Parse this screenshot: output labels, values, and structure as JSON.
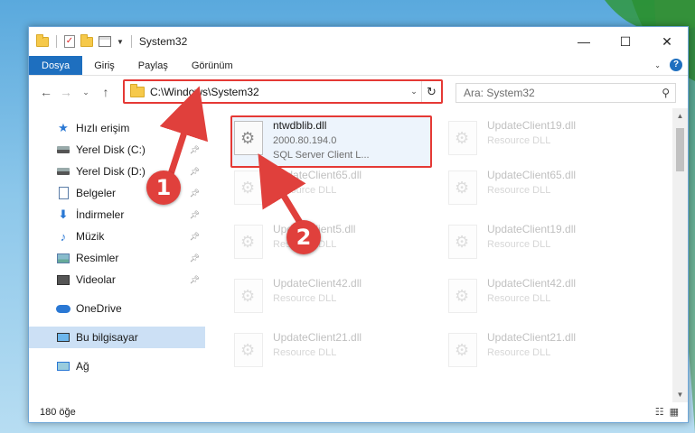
{
  "window": {
    "title": "System32"
  },
  "ribbon": {
    "tabs": [
      "Dosya",
      "Giriş",
      "Paylaş",
      "Görünüm"
    ]
  },
  "address": {
    "path": "C:\\Windows\\System32"
  },
  "search": {
    "placeholder": "Ara: System32"
  },
  "sidebar": {
    "items": [
      {
        "label": "Hızlı erişim",
        "icon": "star-icon",
        "pinned": false
      },
      {
        "label": "Yerel Disk (C:)",
        "icon": "drive-icon",
        "pinned": true
      },
      {
        "label": "Yerel Disk (D:)",
        "icon": "drive-icon",
        "pinned": true
      },
      {
        "label": "Belgeler",
        "icon": "documents-icon",
        "pinned": true
      },
      {
        "label": "İndirmeler",
        "icon": "download-icon",
        "pinned": true
      },
      {
        "label": "Müzik",
        "icon": "music-icon",
        "pinned": true
      },
      {
        "label": "Resimler",
        "icon": "pictures-icon",
        "pinned": true
      },
      {
        "label": "Videolar",
        "icon": "videos-icon",
        "pinned": true
      },
      {
        "label": "OneDrive",
        "icon": "onedrive-icon",
        "pinned": false
      },
      {
        "label": "Bu bilgisayar",
        "icon": "this-pc-icon",
        "pinned": false,
        "selected": true
      },
      {
        "label": "Ağ",
        "icon": "network-icon",
        "pinned": false
      }
    ]
  },
  "files": {
    "highlighted": {
      "name": "ntwdblib.dll",
      "version": "2000.80.194.0",
      "description": "SQL Server Client L..."
    },
    "left": [
      {
        "name": "UpdateClient65.dll",
        "type": "Resource DLL"
      },
      {
        "name": "UpdateClient5.dll",
        "type": "Resource DLL"
      },
      {
        "name": "UpdateClient42.dll",
        "type": "Resource DLL"
      },
      {
        "name": "UpdateClient21.dll",
        "type": "Resource DLL"
      }
    ],
    "right": [
      {
        "name": "UpdateClient19.dll",
        "type": "Resource DLL"
      },
      {
        "name": "UpdateClient65.dll",
        "type": "Resource DLL"
      },
      {
        "name": "UpdateClient19.dll",
        "type": "Resource DLL"
      },
      {
        "name": "UpdateClient42.dll",
        "type": "Resource DLL"
      },
      {
        "name": "UpdateClient21.dll",
        "type": "Resource DLL"
      }
    ]
  },
  "status": {
    "item_count": "180 öğe"
  },
  "markers": {
    "first": "1",
    "second": "2"
  },
  "colors": {
    "highlight_border": "#e53935",
    "marker": "#e0403c",
    "ribbon_file": "#1e6fbf",
    "selection": "#cce0f5"
  }
}
